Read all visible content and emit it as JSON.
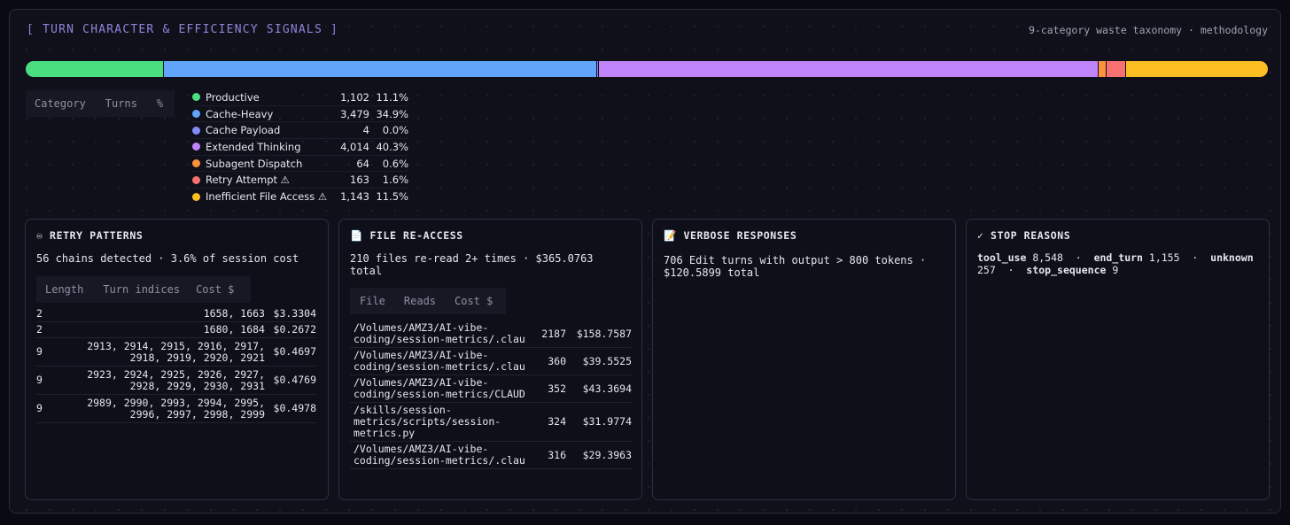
{
  "header": {
    "title": "[ TURN CHARACTER & EFFICIENCY SIGNALS ]",
    "right": "9-category waste taxonomy · methodology"
  },
  "colors": {
    "productive": "#4ade80",
    "cache_heavy": "#60a5fa",
    "cache_payload": "#818cf8",
    "extended_thinking": "#c084fc",
    "subagent_dispatch": "#fb923c",
    "retry_attempt": "#f87171",
    "inefficient_file_access": "#fbbf24"
  },
  "categories_table": {
    "headers": [
      "Category",
      "Turns",
      "%"
    ]
  },
  "categories": [
    {
      "name": "Productive",
      "turns": "1,102",
      "pct": "11.1%",
      "value": 11.1,
      "color": "#4ade80"
    },
    {
      "name": "Cache-Heavy",
      "turns": "3,479",
      "pct": "34.9%",
      "value": 34.9,
      "color": "#60a5fa"
    },
    {
      "name": "Cache Payload",
      "turns": "4",
      "pct": "0.0%",
      "value": 0.04,
      "color": "#818cf8"
    },
    {
      "name": "Extended Thinking",
      "turns": "4,014",
      "pct": "40.3%",
      "value": 40.3,
      "color": "#c084fc"
    },
    {
      "name": "Subagent Dispatch",
      "turns": "64",
      "pct": "0.6%",
      "value": 0.6,
      "color": "#fb923c"
    },
    {
      "name": "Retry Attempt ⚠",
      "turns": "163",
      "pct": "1.6%",
      "value": 1.6,
      "color": "#f87171"
    },
    {
      "name": "Inefficient File Access ⚠",
      "turns": "1,143",
      "pct": "11.5%",
      "value": 11.5,
      "color": "#fbbf24"
    }
  ],
  "retry": {
    "icon": "infinity-icon",
    "title": "♾ RETRY PATTERNS",
    "summary": "56 chains detected  ·  3.6% of session cost",
    "headers": [
      "Length",
      "Turn indices",
      "Cost $"
    ],
    "rows": [
      {
        "length": "2",
        "indices": [
          "1658, 1663"
        ],
        "cost": "$3.3304"
      },
      {
        "length": "2",
        "indices": [
          "1680, 1684"
        ],
        "cost": "$0.2672"
      },
      {
        "length": "9",
        "indices": [
          "2913, 2914, 2915, 2916, 2917,",
          "2918, 2919, 2920, 2921"
        ],
        "cost": "$0.4697"
      },
      {
        "length": "9",
        "indices": [
          "2923, 2924, 2925, 2926, 2927,",
          "2928, 2929, 2930, 2931"
        ],
        "cost": "$0.4769"
      },
      {
        "length": "9",
        "indices": [
          "2989, 2990, 2993, 2994, 2995,",
          "2996, 2997, 2998, 2999"
        ],
        "cost": "$0.4978"
      }
    ]
  },
  "file_reaccess": {
    "icon": "document-icon",
    "title": "📄 FILE RE-ACCESS",
    "summary_line1": "210 files re-read 2+ times  ·  $365.0763",
    "summary_line2": "total",
    "headers": [
      "File",
      "Reads",
      "Cost $"
    ],
    "rows": [
      {
        "file": [
          "/Volumes/AMZ3/AI-vibe-",
          "coding/session-metrics/.clau"
        ],
        "reads": "2187",
        "cost": "$158.7587"
      },
      {
        "file": [
          "/Volumes/AMZ3/AI-vibe-",
          "coding/session-metrics/.clau"
        ],
        "reads": "360",
        "cost": "$39.5525"
      },
      {
        "file": [
          "/Volumes/AMZ3/AI-vibe-",
          "coding/session-metrics/CLAUD"
        ],
        "reads": "352",
        "cost": "$43.3694"
      },
      {
        "file": [
          "/skills/session-",
          "metrics/scripts/session-",
          "metrics.py"
        ],
        "reads": "324",
        "cost": "$31.9774"
      },
      {
        "file": [
          "/Volumes/AMZ3/AI-vibe-",
          "coding/session-metrics/.clau"
        ],
        "reads": "316",
        "cost": "$29.3963"
      }
    ]
  },
  "verbose": {
    "icon": "memo-icon",
    "title": "📝 VERBOSE RESPONSES",
    "summary_line1": "706 Edit turns with output > 800 tokens  ·",
    "summary_line2": "$120.5899 total"
  },
  "stop": {
    "icon": "check-icon",
    "title": "✓ STOP REASONS",
    "reasons": [
      {
        "name": "tool_use",
        "count": "8,548"
      },
      {
        "name": "end_turn",
        "count": "1,155"
      },
      {
        "name": "unknown",
        "count": "257"
      },
      {
        "name": "stop_sequence",
        "count": "9"
      }
    ],
    "separator": "  ·  "
  }
}
